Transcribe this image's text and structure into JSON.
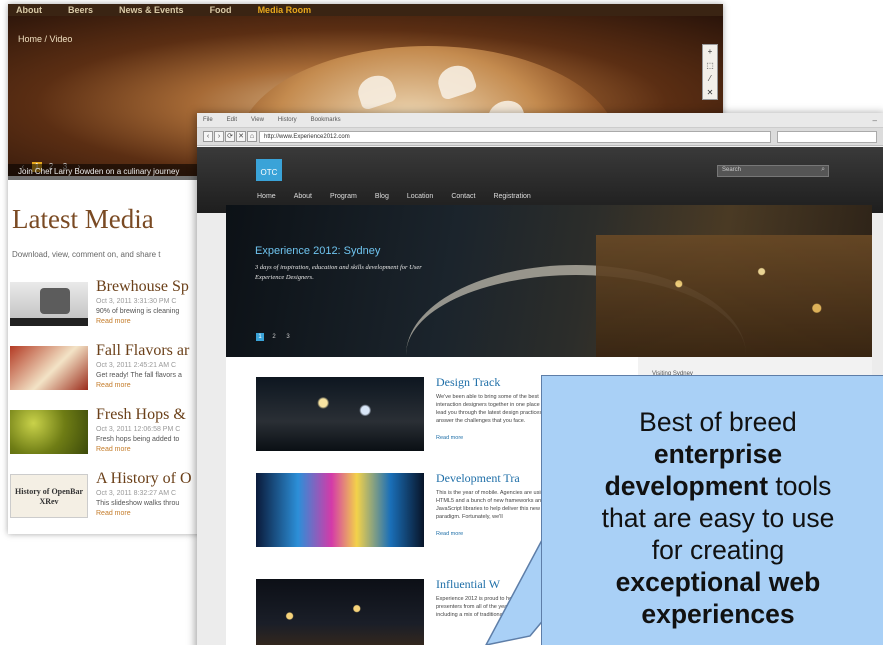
{
  "back_window": {
    "nav": [
      "About",
      "Beers",
      "News & Events",
      "Food",
      "Media Room"
    ],
    "breadcrumb": "Home / Video",
    "tools": [
      "+",
      "⬚",
      "⁄",
      "✕"
    ],
    "pager": [
      "‹",
      "1",
      "2",
      "3",
      "›"
    ],
    "caption": "Join Chef Larry Bowden on a culinary journey",
    "latest_title": "Latest Media",
    "latest_sub": "Download, view, comment on, and share t",
    "items": [
      {
        "title": "Brewhouse Sp",
        "date": "Oct 3, 2011 3:31:30 PM C",
        "desc": "90% of brewing is cleaning",
        "more": "Read more"
      },
      {
        "title": "Fall Flavors ar",
        "date": "Oct 3, 2011 2:45:21 AM C",
        "desc": "Get ready! The fall flavors a",
        "more": "Read more"
      },
      {
        "title": "Fresh Hops &",
        "date": "Oct 3, 2011 12:06:58 PM C",
        "desc": "Fresh hops being added to",
        "more": "Read more"
      },
      {
        "title": "A History of O",
        "date": "Oct 3, 2011 8:32:27 AM C",
        "desc": "This slideshow walks throu",
        "more": "Read more",
        "thumb_text": "History of OpenBar XRev"
      }
    ]
  },
  "front_window": {
    "menubar": [
      "File",
      "Edit",
      "View",
      "History",
      "Bookmarks"
    ],
    "minimize": "–",
    "nav_buttons": [
      "‹",
      "›",
      "⟳",
      "✕",
      "⌂"
    ],
    "url": "http://www.Experience2012.com",
    "logo": "OTC",
    "search_placeholder": "Search",
    "nav": [
      "Home",
      "About",
      "Program",
      "Blog",
      "Location",
      "Contact",
      "Registration"
    ],
    "hero_title": "Experience 2012: Sydney",
    "hero_subtitle": "3 days of inspiration, education and skills development for User Experience Designers.",
    "hero_pager": [
      "1",
      "2",
      "3"
    ],
    "sidebar_title": "Visiting Sydney",
    "tracks": [
      {
        "title": "Design Track",
        "desc": "We've been able to bring some of the best interaction designers together in one place to lead you through the latest design practices and answer the challenges that you face.",
        "more": "Read more"
      },
      {
        "title": "Development Tra",
        "desc": "This is the year of mobile. Agencies are using HTML5 and a bunch of new frameworks and JavaScript libraries to help deliver this new web paradigm. Fortunately, we'll",
        "more": "Read more"
      },
      {
        "title": "Influential W",
        "desc": "Experience 2012 is proud to host influential web presenters from all of the year's conferences, including a mix of traditional",
        "more": ""
      }
    ]
  },
  "callout": {
    "line1": "Best of breed",
    "line2_bold": "enterprise",
    "line3_bold": "development",
    "line3_rest": " tools",
    "line4": "that are easy to use",
    "line5": "for creating",
    "line6_bold": "exceptional web",
    "line7_bold": "experiences"
  }
}
